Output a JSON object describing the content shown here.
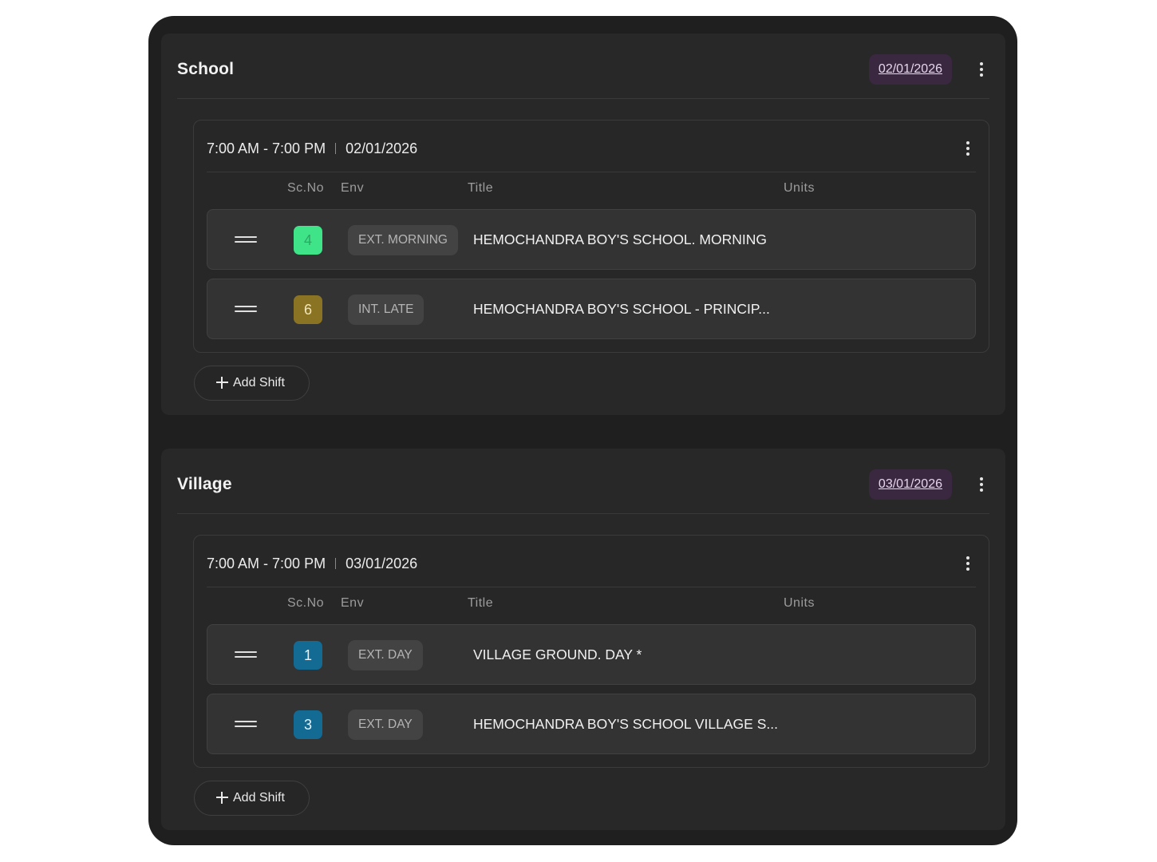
{
  "columns": {
    "scno": "Sc.No",
    "env": "Env",
    "title": "Title",
    "units": "Units"
  },
  "add_shift_label": "Add Shift",
  "locations": [
    {
      "name": "School",
      "date": "02/01/2026",
      "shift": {
        "time": "7:00 AM - 7:00 PM",
        "date": "02/01/2026",
        "scenes": [
          {
            "scno": "4",
            "scno_color": "#3fe488",
            "scno_text_color": "#2ea866",
            "env": "EXT. MORNING",
            "title": "HEMOCHANDRA BOY'S SCHOOL. MORNING"
          },
          {
            "scno": "6",
            "scno_color": "#8a7424",
            "scno_text_color": "#f3e7b8",
            "env": "INT. LATE",
            "title": "HEMOCHANDRA BOY'S SCHOOL - PRINCIP..."
          }
        ]
      }
    },
    {
      "name": "Village",
      "date": "03/01/2026",
      "shift": {
        "time": "7:00 AM - 7:00 PM",
        "date": "03/01/2026",
        "scenes": [
          {
            "scno": "1",
            "scno_color": "#136a93",
            "scno_text_color": "#e4f3fb",
            "env": "EXT. DAY",
            "title": "VILLAGE GROUND. DAY *"
          },
          {
            "scno": "3",
            "scno_color": "#136a93",
            "scno_text_color": "#e4f3fb",
            "env": "EXT. DAY",
            "title": "HEMOCHANDRA BOY'S SCHOOL VILLAGE S..."
          }
        ]
      }
    }
  ]
}
